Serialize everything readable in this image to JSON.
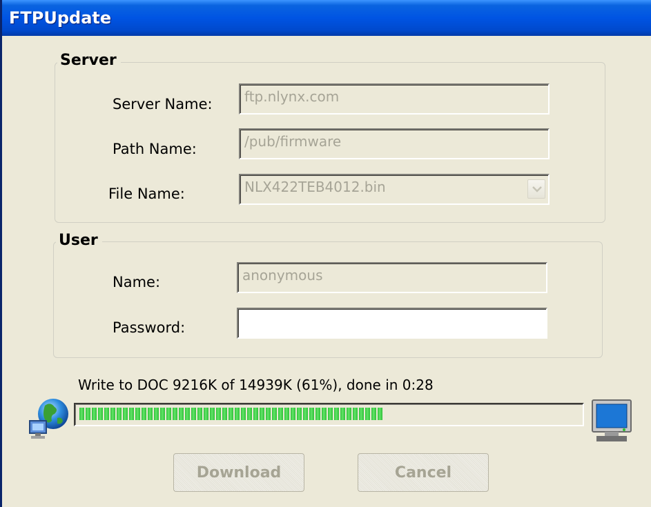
{
  "window": {
    "title": "FTPUpdate"
  },
  "server": {
    "legend": "Server",
    "server_name_label": "Server Name:",
    "server_name_value": "ftp.nlynx.com",
    "path_name_label": "Path Name:",
    "path_name_value": "/pub/firmware",
    "file_name_label": "File Name:",
    "file_name_value": "NLX422TEB4012.bin"
  },
  "user": {
    "legend": "User",
    "name_label": "Name:",
    "name_value": "anonymous",
    "password_label": "Password:",
    "password_value": ""
  },
  "progress": {
    "status_text": "Write to DOC 9216K of 14939K (61%), done in 0:28",
    "fraction": 0.61,
    "fill_color": "#2fc038"
  },
  "buttons": {
    "download_label": "Download",
    "cancel_label": "Cancel"
  },
  "icons": {
    "source": "globe-network-icon",
    "target": "computer-monitor-icon"
  }
}
